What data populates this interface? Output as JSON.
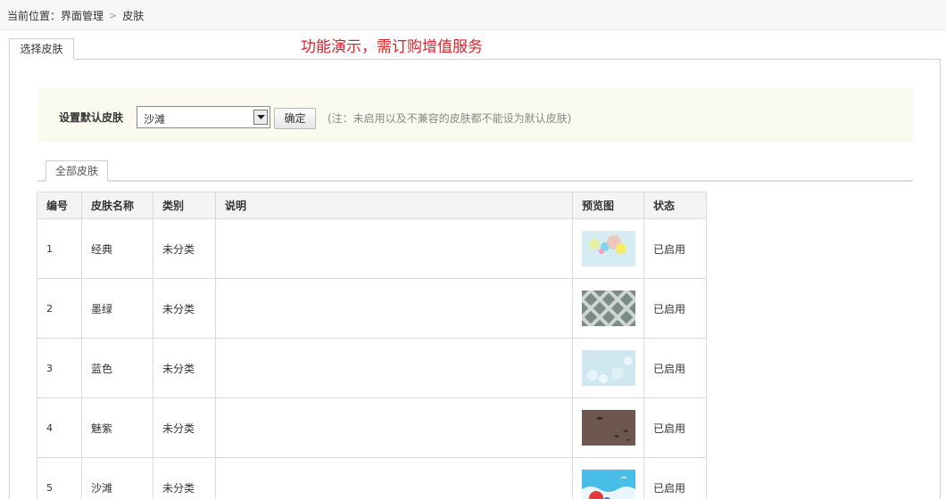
{
  "breadcrumb": {
    "prefix": "当前位置：",
    "section": "界面管理",
    "current": "皮肤"
  },
  "tabs": {
    "select_skin": "选择皮肤",
    "all_skins": "全部皮肤"
  },
  "promo": "功能演示，需订购增值服务",
  "setting": {
    "label": "设置默认皮肤",
    "selected": "沙滩",
    "confirm": "确定",
    "note": "(注：未启用以及不兼容的皮肤都不能设为默认皮肤)"
  },
  "table": {
    "headers": [
      "编号",
      "皮肤名称",
      "类别",
      "说明",
      "预览图",
      "状态"
    ],
    "rows": [
      {
        "id": "1",
        "name": "经典",
        "category": "未分类",
        "desc": "",
        "preview": "bubbles-thumbnail",
        "status": "已启用"
      },
      {
        "id": "2",
        "name": "墨绿",
        "category": "未分类",
        "desc": "",
        "preview": "green-pattern-thumbnail",
        "status": "已启用"
      },
      {
        "id": "3",
        "name": "蓝色",
        "category": "未分类",
        "desc": "",
        "preview": "light-blue-thumbnail",
        "status": "已启用"
      },
      {
        "id": "4",
        "name": "魅紫",
        "category": "未分类",
        "desc": "",
        "preview": "purple-birds-thumbnail",
        "status": "已启用"
      },
      {
        "id": "5",
        "name": "沙滩",
        "category": "未分类",
        "desc": "",
        "preview": "beach-balloon-thumbnail",
        "status": "已启用"
      }
    ]
  },
  "colors": {
    "promo": "#d9232a",
    "setting_bg": "#fbfaef",
    "header_bg": "#f4f4f4"
  }
}
